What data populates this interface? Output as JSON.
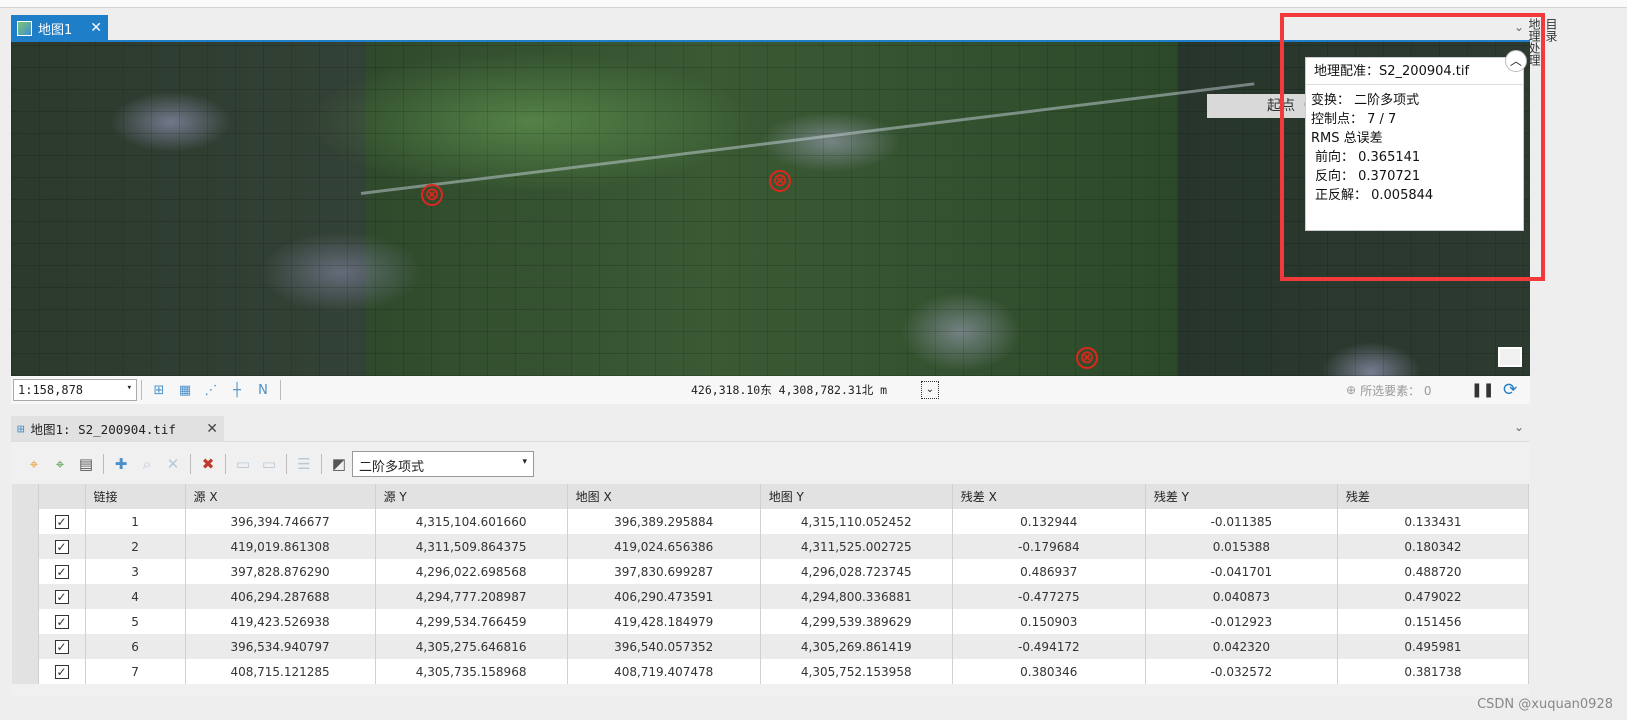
{
  "map_tab": {
    "label": "地图1",
    "close": "✕"
  },
  "map": {
    "start_label": "起点（",
    "gcp_marker": "⊗"
  },
  "popup": {
    "title": "地理配准：S2_200904.tif",
    "transform": "变换： 二阶多项式",
    "control_points": "控制点： 7 / 7",
    "rms_title": "RMS 总误差",
    "forward": "前向： 0.365141",
    "inverse": "反向： 0.370721",
    "forward_inverse": "正反解： 0.005844"
  },
  "side_tabs": [
    "目录",
    "地理处理"
  ],
  "status": {
    "scale": "1:158,878",
    "coords": "426,318.10东  4,308,782.31北 m",
    "selected_label": "所选要素： 0"
  },
  "bottom_tab": {
    "label": "地图1: S2_200904.tif",
    "close": "✕"
  },
  "toolbar": {
    "transform_select": "二阶多项式"
  },
  "table": {
    "headers": [
      "链接",
      "源 X",
      "源 Y",
      "地图 X",
      "地图 Y",
      "残差 X",
      "残差 Y",
      "残差"
    ],
    "rows": [
      [
        "1",
        "396,394.746677",
        "4,315,104.601660",
        "396,389.295884",
        "4,315,110.052452",
        "0.132944",
        "-0.011385",
        "0.133431"
      ],
      [
        "2",
        "419,019.861308",
        "4,311,509.864375",
        "419,024.656386",
        "4,311,525.002725",
        "-0.179684",
        "0.015388",
        "0.180342"
      ],
      [
        "3",
        "397,828.876290",
        "4,296,022.698568",
        "397,830.699287",
        "4,296,028.723745",
        "0.486937",
        "-0.041701",
        "0.488720"
      ],
      [
        "4",
        "406,294.287688",
        "4,294,777.208987",
        "406,290.473591",
        "4,294,800.336881",
        "-0.477275",
        "0.040873",
        "0.479022"
      ],
      [
        "5",
        "419,423.526938",
        "4,299,534.766459",
        "419,428.184979",
        "4,299,539.389629",
        "0.150903",
        "-0.012923",
        "0.151456"
      ],
      [
        "6",
        "396,534.940797",
        "4,305,275.646816",
        "396,540.057352",
        "4,305,269.861419",
        "-0.494172",
        "0.042320",
        "0.495981"
      ],
      [
        "7",
        "408,715.121285",
        "4,305,735.158968",
        "408,719.407478",
        "4,305,752.153958",
        "0.380346",
        "-0.032572",
        "0.381738"
      ]
    ]
  },
  "watermark": "CSDN @xuquan0928"
}
